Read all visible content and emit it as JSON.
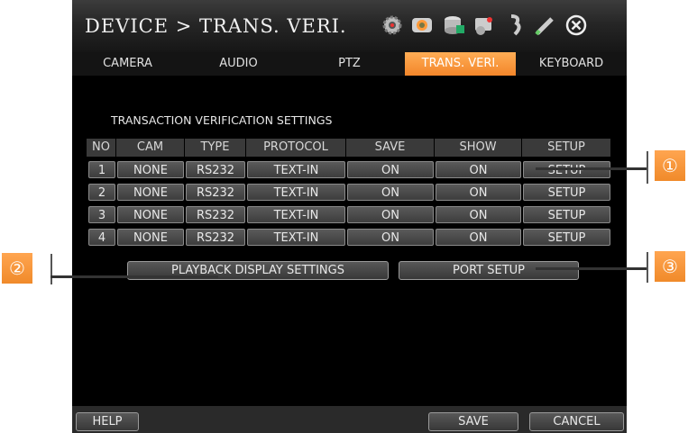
{
  "title": "DEVICE > TRANS. VERI.",
  "toolbar_icons": [
    "gear-icon",
    "camera-icon",
    "disk-icon",
    "network-icon",
    "wrench-icon",
    "pen-icon",
    "close-icon"
  ],
  "tabs": [
    {
      "label": "CAMERA",
      "active": false
    },
    {
      "label": "AUDIO",
      "active": false
    },
    {
      "label": "PTZ",
      "active": false
    },
    {
      "label": "TRANS. VERI.",
      "active": true
    },
    {
      "label": "KEYBOARD",
      "active": false
    }
  ],
  "section_title": "TRANSACTION VERIFICATION SETTINGS",
  "columns": [
    "NO",
    "CAM",
    "TYPE",
    "PROTOCOL",
    "SAVE",
    "SHOW",
    "SETUP"
  ],
  "rows": [
    {
      "no": "1",
      "cam": "NONE",
      "type": "RS232",
      "protocol": "TEXT-IN",
      "save": "ON",
      "show": "ON",
      "setup": "SETUP"
    },
    {
      "no": "2",
      "cam": "NONE",
      "type": "RS232",
      "protocol": "TEXT-IN",
      "save": "ON",
      "show": "ON",
      "setup": "SETUP"
    },
    {
      "no": "3",
      "cam": "NONE",
      "type": "RS232",
      "protocol": "TEXT-IN",
      "save": "ON",
      "show": "ON",
      "setup": "SETUP"
    },
    {
      "no": "4",
      "cam": "NONE",
      "type": "RS232",
      "protocol": "TEXT-IN",
      "save": "ON",
      "show": "ON",
      "setup": "SETUP"
    }
  ],
  "buttons": {
    "playback": "PLAYBACK DISPLAY SETTINGS",
    "port_setup": "PORT SETUP",
    "help": "HELP",
    "save": "SAVE",
    "cancel": "CANCEL"
  },
  "callouts": [
    "①",
    "②",
    "③"
  ],
  "colors": {
    "accent": "#f3862a",
    "background": "#000000"
  }
}
